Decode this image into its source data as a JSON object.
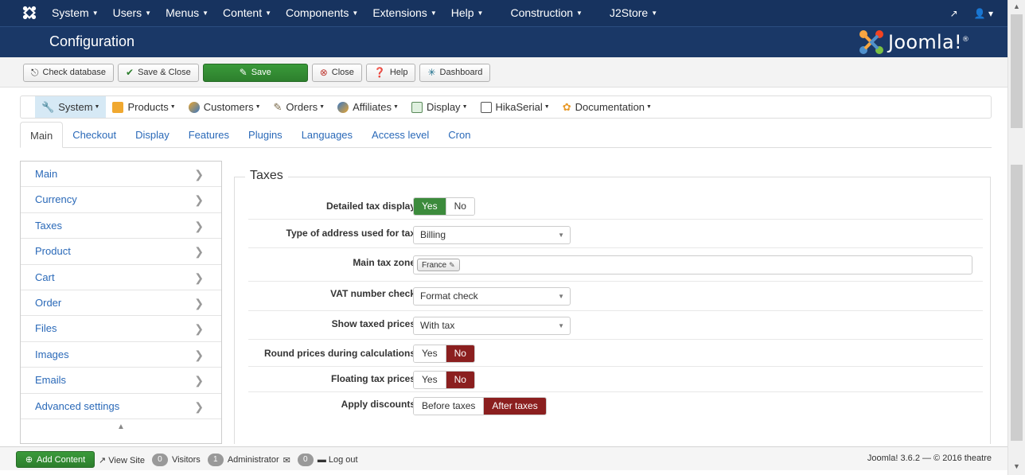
{
  "topbar": {
    "menu": [
      {
        "label": "System"
      },
      {
        "label": "Users"
      },
      {
        "label": "Menus"
      },
      {
        "label": "Content"
      },
      {
        "label": "Components"
      },
      {
        "label": "Extensions"
      },
      {
        "label": "Help"
      },
      {
        "label": "Construction"
      },
      {
        "label": "J2Store"
      }
    ],
    "right_icons": [
      "external-link-icon",
      "user-icon"
    ]
  },
  "header": {
    "title": "Configuration",
    "logo_text": "Joomla!",
    "logo_sup": "®"
  },
  "toolbar": {
    "buttons": [
      {
        "label": "Check database",
        "icon": "database-check-icon"
      },
      {
        "label": "Save & Close",
        "icon": "checkmark-icon"
      },
      {
        "label": "Save",
        "icon": "edit-icon"
      },
      {
        "label": "Close",
        "icon": "close-icon"
      },
      {
        "label": "Help",
        "icon": "question-icon"
      },
      {
        "label": "Dashboard",
        "icon": "dashboard-icon"
      }
    ]
  },
  "component_menu": [
    {
      "label": "System",
      "icon": "system-icon"
    },
    {
      "label": "Products",
      "icon": "products-icon"
    },
    {
      "label": "Customers",
      "icon": "customers-icon"
    },
    {
      "label": "Orders",
      "icon": "orders-icon"
    },
    {
      "label": "Affiliates",
      "icon": "affiliates-icon"
    },
    {
      "label": "Display",
      "icon": "display-icon"
    },
    {
      "label": "HikaSerial",
      "icon": "hikaserial-icon"
    },
    {
      "label": "Documentation",
      "icon": "documentation-icon"
    }
  ],
  "tabs": [
    {
      "label": "Main"
    },
    {
      "label": "Checkout"
    },
    {
      "label": "Display"
    },
    {
      "label": "Features"
    },
    {
      "label": "Plugins"
    },
    {
      "label": "Languages"
    },
    {
      "label": "Access level"
    },
    {
      "label": "Cron"
    }
  ],
  "leftnav": [
    {
      "label": "Main"
    },
    {
      "label": "Currency"
    },
    {
      "label": "Taxes"
    },
    {
      "label": "Product"
    },
    {
      "label": "Cart"
    },
    {
      "label": "Order"
    },
    {
      "label": "Files"
    },
    {
      "label": "Images"
    },
    {
      "label": "Emails"
    },
    {
      "label": "Advanced settings"
    }
  ],
  "taxes": {
    "legend": "Taxes",
    "detailed_tax_display": {
      "label": "Detailed tax display",
      "yes": "Yes",
      "no": "No",
      "value": "Yes"
    },
    "address_type": {
      "label": "Type of address used for tax",
      "value": "Billing"
    },
    "main_tax_zone": {
      "label": "Main tax zone",
      "tag": "France"
    },
    "vat_check": {
      "label": "VAT number check",
      "value": "Format check"
    },
    "show_taxed_prices": {
      "label": "Show taxed prices",
      "value": "With tax"
    },
    "round_prices": {
      "label": "Round prices during calculations",
      "yes": "Yes",
      "no": "No",
      "value": "No"
    },
    "floating_tax": {
      "label": "Floating tax prices",
      "yes": "Yes",
      "no": "No",
      "value": "No"
    },
    "apply_discounts": {
      "label": "Apply discounts",
      "before": "Before taxes",
      "after": "After taxes",
      "value": "After taxes"
    }
  },
  "statusbar": {
    "add_content": "Add Content",
    "view_site": "View Site",
    "visitors_count": "0",
    "visitors": "Visitors",
    "admin_count": "1",
    "administrator": "Administrator",
    "messages_count": "0",
    "log_out": "Log out",
    "version": "Joomla! 3.6.2 — © 2016 theatre"
  }
}
